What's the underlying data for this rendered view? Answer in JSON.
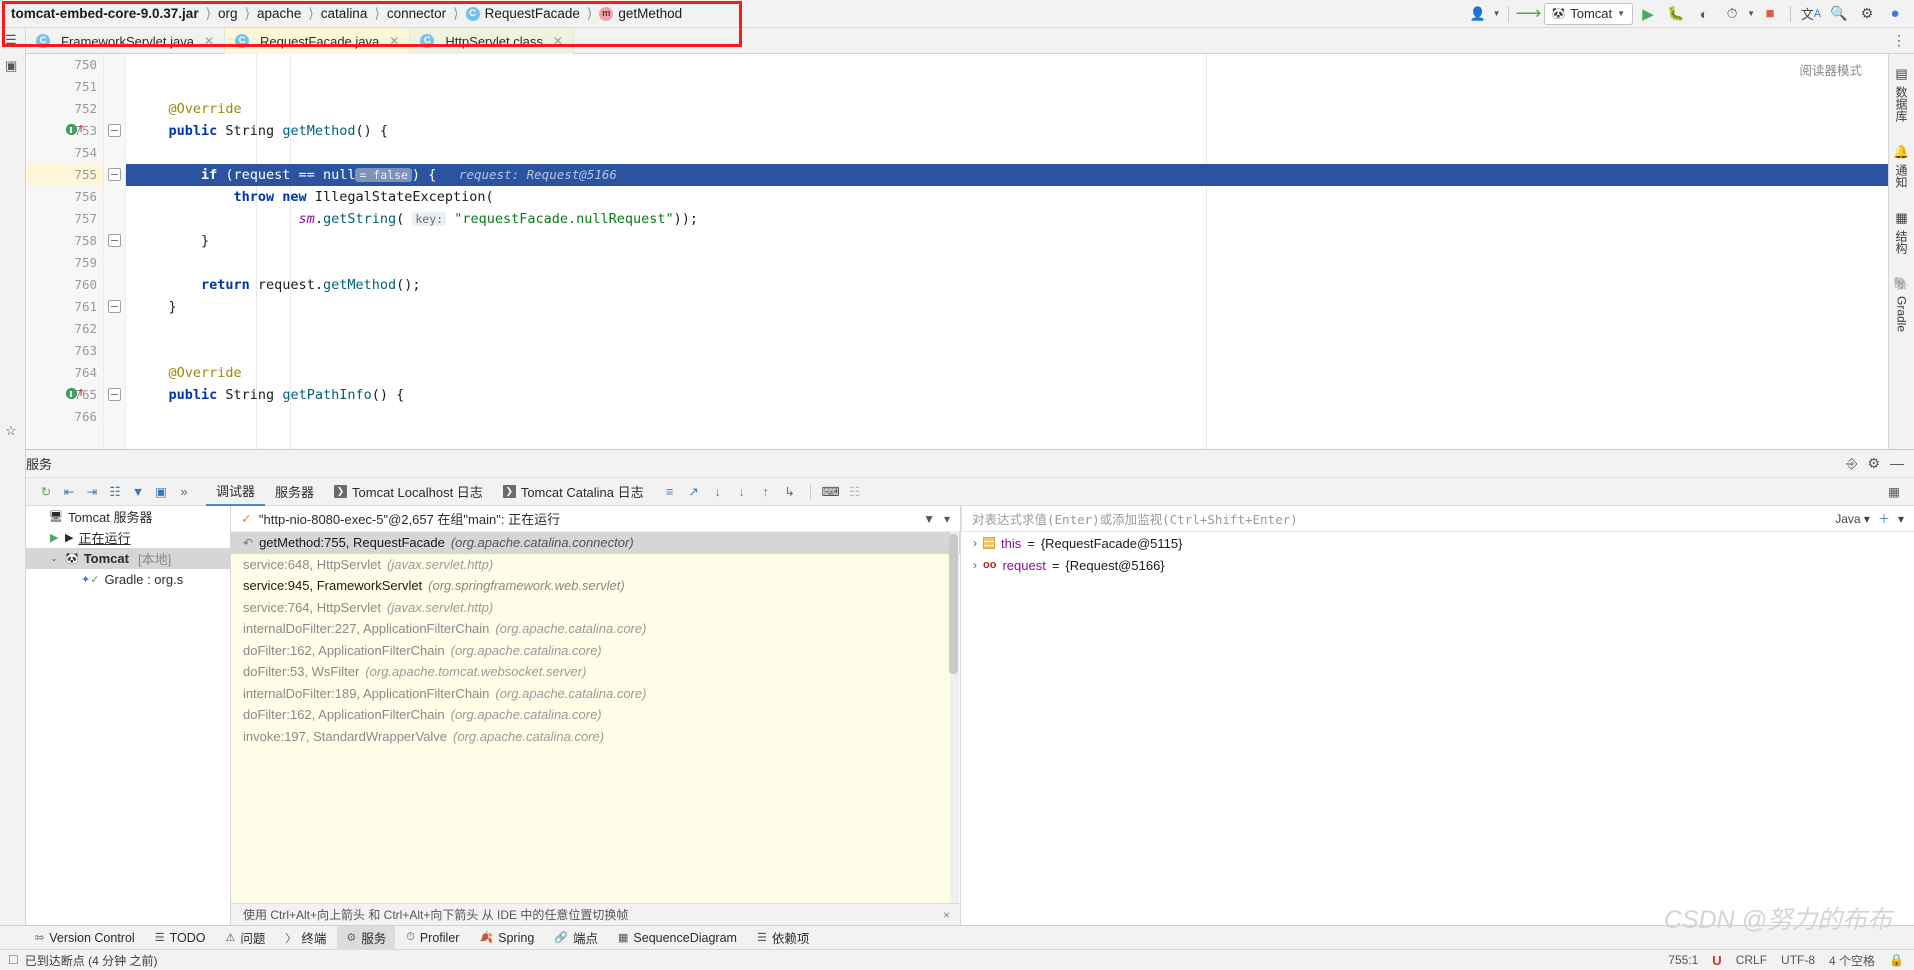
{
  "breadcrumb": {
    "items": [
      {
        "label": "tomcat-embed-core-9.0.37.jar",
        "icon": "jar-icon",
        "bold": true
      },
      {
        "label": "org",
        "icon": "package-icon"
      },
      {
        "label": "apache",
        "icon": "package-icon"
      },
      {
        "label": "catalina",
        "icon": "package-icon"
      },
      {
        "label": "connector",
        "icon": "package-icon"
      },
      {
        "label": "RequestFacade",
        "icon": "class-icon",
        "badge": "C"
      },
      {
        "label": "getMethod",
        "icon": "method-icon",
        "badge": "m"
      }
    ]
  },
  "toolbar": {
    "user_icon": "user-icon",
    "updates_icon": "vcs-update-icon",
    "run_config": {
      "label": "Tomcat",
      "icon": "tomcat-icon",
      "caret": "▼"
    },
    "run_label": "Run",
    "debug_label": "Debug",
    "coverage_label": "Run with Coverage",
    "profile_label": "Profile",
    "stop_label": "Stop",
    "translate_label": "Translate",
    "search_label": "Search Everywhere",
    "settings_label": "Settings",
    "ide_label": "IDE Assistant"
  },
  "editor_tabs": [
    {
      "label": "FrameworkServlet.java",
      "badge": "C",
      "state": "normal"
    },
    {
      "label": "RequestFacade.java",
      "badge": "C",
      "state": "selected"
    },
    {
      "label": "HttpServlet.class",
      "badge": "C",
      "state": "alt"
    }
  ],
  "editor": {
    "reader_mode": "阅读器模式",
    "inspection_ok": "✓",
    "first_line": 750,
    "exec_line": 755,
    "lines": [
      {
        "n": 750,
        "tokens": []
      },
      {
        "n": 751,
        "tokens": []
      },
      {
        "n": 752,
        "tokens": [
          {
            "t": "ann",
            "v": "    @Override"
          }
        ]
      },
      {
        "n": 753,
        "marker": true,
        "tokens": [
          {
            "t": "k",
            "v": "    public "
          },
          {
            "t": "idt",
            "v": "String "
          },
          {
            "t": "mth",
            "v": "getMethod"
          },
          {
            "t": "idt",
            "v": "() {"
          }
        ]
      },
      {
        "n": 754,
        "tokens": []
      },
      {
        "n": 755,
        "exec": true,
        "tokens": [
          {
            "t": "k",
            "v": "        if "
          },
          {
            "t": "idt",
            "v": "(request == null"
          },
          {
            "t": "inlay",
            "v": "= false"
          },
          {
            "t": "idt",
            "v": ") {"
          },
          {
            "t": "dbg",
            "v": "   request: Request@5166"
          }
        ]
      },
      {
        "n": 756,
        "tokens": [
          {
            "t": "k",
            "v": "            throw new "
          },
          {
            "t": "idt",
            "v": "IllegalStateException("
          }
        ]
      },
      {
        "n": 757,
        "tokens": [
          {
            "t": "fld",
            "v": "                    sm"
          },
          {
            "t": "idt",
            "v": "."
          },
          {
            "t": "mth",
            "v": "getString"
          },
          {
            "t": "idt",
            "v": "( "
          },
          {
            "t": "inlayk",
            "v": "key:"
          },
          {
            "t": "str",
            "v": " \"requestFacade.nullRequest\""
          },
          {
            "t": "idt",
            "v": "));"
          }
        ]
      },
      {
        "n": 758,
        "tokens": [
          {
            "t": "idt",
            "v": "        }"
          }
        ]
      },
      {
        "n": 759,
        "tokens": []
      },
      {
        "n": 760,
        "tokens": [
          {
            "t": "k",
            "v": "        return "
          },
          {
            "t": "idt",
            "v": "request."
          },
          {
            "t": "mth",
            "v": "getMethod"
          },
          {
            "t": "idt",
            "v": "();"
          }
        ]
      },
      {
        "n": 761,
        "tokens": [
          {
            "t": "idt",
            "v": "    }"
          }
        ]
      },
      {
        "n": 762,
        "tokens": []
      },
      {
        "n": 763,
        "tokens": []
      },
      {
        "n": 764,
        "tokens": [
          {
            "t": "ann",
            "v": "    @Override"
          }
        ]
      },
      {
        "n": 765,
        "marker": true,
        "tokens": [
          {
            "t": "k",
            "v": "    public "
          },
          {
            "t": "idt",
            "v": "String "
          },
          {
            "t": "mth",
            "v": "getPathInfo"
          },
          {
            "t": "idt",
            "v": "() {"
          }
        ]
      },
      {
        "n": 766,
        "tokens": []
      }
    ]
  },
  "right_toolwindows": [
    {
      "label": "数据库",
      "icon": "database-icon"
    },
    {
      "label": "通知",
      "icon": "notifications-icon"
    },
    {
      "label": "结构",
      "icon": "structure-icon"
    },
    {
      "label": "Gradle",
      "icon": "gradle-icon"
    }
  ],
  "services": {
    "title": "服务",
    "settings_icon": "gear-icon",
    "help_icon": "help-icon",
    "minimize_icon": "minimize-icon",
    "tabs": [
      {
        "label": "调试器",
        "active": true
      },
      {
        "label": "服务器",
        "active": false
      },
      {
        "label": "Tomcat Localhost 日志",
        "active": false,
        "icon": "console-icon"
      },
      {
        "label": "Tomcat Catalina 日志",
        "active": false,
        "icon": "console-icon"
      }
    ],
    "step_actions": [
      {
        "name": "show-execution-point",
        "glyph": "≡"
      },
      {
        "name": "step-over",
        "glyph": "⤵"
      },
      {
        "name": "step-into",
        "glyph": "↓"
      },
      {
        "name": "force-step-into",
        "glyph": "↓"
      },
      {
        "name": "step-out",
        "glyph": "↑"
      },
      {
        "name": "run-to-cursor",
        "glyph": "↳"
      },
      {
        "name": "evaluate-expression",
        "glyph": "⌨"
      },
      {
        "name": "mute-breakpoints",
        "glyph": "⋮⋮"
      }
    ],
    "tree": [
      {
        "label": "Tomcat 服务器",
        "indent": 0,
        "icon": "server-icon",
        "arrow": ""
      },
      {
        "label": "正在运行",
        "indent": 1,
        "icon": "run-icon",
        "arrow": "▶"
      },
      {
        "label": "Tomcat",
        "suffix": "[本地]",
        "indent": 1,
        "icon": "tomcat-icon",
        "arrow": "⌄",
        "selected": true
      },
      {
        "label": "Gradle : org.s",
        "indent": 2,
        "icon": "artifact-icon",
        "arrow": ""
      }
    ]
  },
  "frames": {
    "thread": "\"http-nio-8080-exec-5\"@2,657 在组\"main\": 正在运行",
    "thread_icon": "thread-running-icon",
    "filter_icon": "filter-icon",
    "caret_icon": "chevron-down-icon",
    "rows": [
      {
        "m": "getMethod:755, RequestFacade",
        "p": "(org.apache.catalina.connector)",
        "sel": true,
        "icon": "return-icon"
      },
      {
        "m": "service:648, HttpServlet",
        "p": "(javax.servlet.http)",
        "dim": true
      },
      {
        "m": "service:945, FrameworkServlet",
        "p": "(org.springframework.web.servlet)",
        "strong": true
      },
      {
        "m": "service:764, HttpServlet",
        "p": "(javax.servlet.http)",
        "dim": true
      },
      {
        "m": "internalDoFilter:227, ApplicationFilterChain",
        "p": "(org.apache.catalina.core)",
        "dim": true
      },
      {
        "m": "doFilter:162, ApplicationFilterChain",
        "p": "(org.apache.catalina.core)",
        "dim": true
      },
      {
        "m": "doFilter:53, WsFilter",
        "p": "(org.apache.tomcat.websocket.server)",
        "dim": true
      },
      {
        "m": "internalDoFilter:189, ApplicationFilterChain",
        "p": "(org.apache.catalina.core)",
        "dim": true
      },
      {
        "m": "doFilter:162, ApplicationFilterChain",
        "p": "(org.apache.catalina.core)",
        "dim": true
      },
      {
        "m": "invoke:197, StandardWrapperValve",
        "p": "(org.apache.catalina.core)",
        "dim": true
      }
    ],
    "hint": "使用 Ctrl+Alt+向上箭头 和 Ctrl+Alt+向下箭头 从 IDE 中的任意位置切换帧",
    "hint_close": "×"
  },
  "variables": {
    "watch_placeholder": "对表达式求值(Enter)或添加监视(Ctrl+Shift+Enter)",
    "language": "Java",
    "add_icon": "add-watch-icon",
    "settings_icon": "chevron-down-icon",
    "rows": [
      {
        "arrow": "›",
        "icon": "object-icon",
        "name": "this",
        "eq": "=",
        "value": "{RequestFacade@5115}"
      },
      {
        "arrow": "›",
        "icon": "param-icon",
        "name": "request",
        "eq": "=",
        "value": "{Request@5166}"
      }
    ]
  },
  "bottom_tool_tabs": [
    {
      "label": "Version Control",
      "icon": "vcs-icon"
    },
    {
      "label": "TODO",
      "icon": "todo-icon"
    },
    {
      "label": "问题",
      "icon": "problems-icon"
    },
    {
      "label": "终端",
      "icon": "terminal-icon"
    },
    {
      "label": "服务",
      "icon": "services-icon",
      "active": true
    },
    {
      "label": "Profiler",
      "icon": "profiler-icon"
    },
    {
      "label": "Spring",
      "icon": "spring-icon"
    },
    {
      "label": "端点",
      "icon": "endpoints-icon"
    },
    {
      "label": "SequenceDiagram",
      "icon": "sequence-icon"
    },
    {
      "label": "依赖项",
      "icon": "dependencies-icon"
    }
  ],
  "statusbar": {
    "message": "已到达断点 (4 分钟 之前)",
    "caret": "755:1",
    "vcs_badge": "U",
    "line_sep": "CRLF",
    "encoding": "UTF-8",
    "indent": "4 个空格"
  },
  "watermark": "CSDN @努力的布布",
  "colors": {
    "exec_line": "#2c53a0",
    "tab_selected": "#fdf6d8",
    "frames_bg": "#fffde8",
    "accent": "#4a88c7",
    "annotation_box": "#ff1a1a"
  }
}
